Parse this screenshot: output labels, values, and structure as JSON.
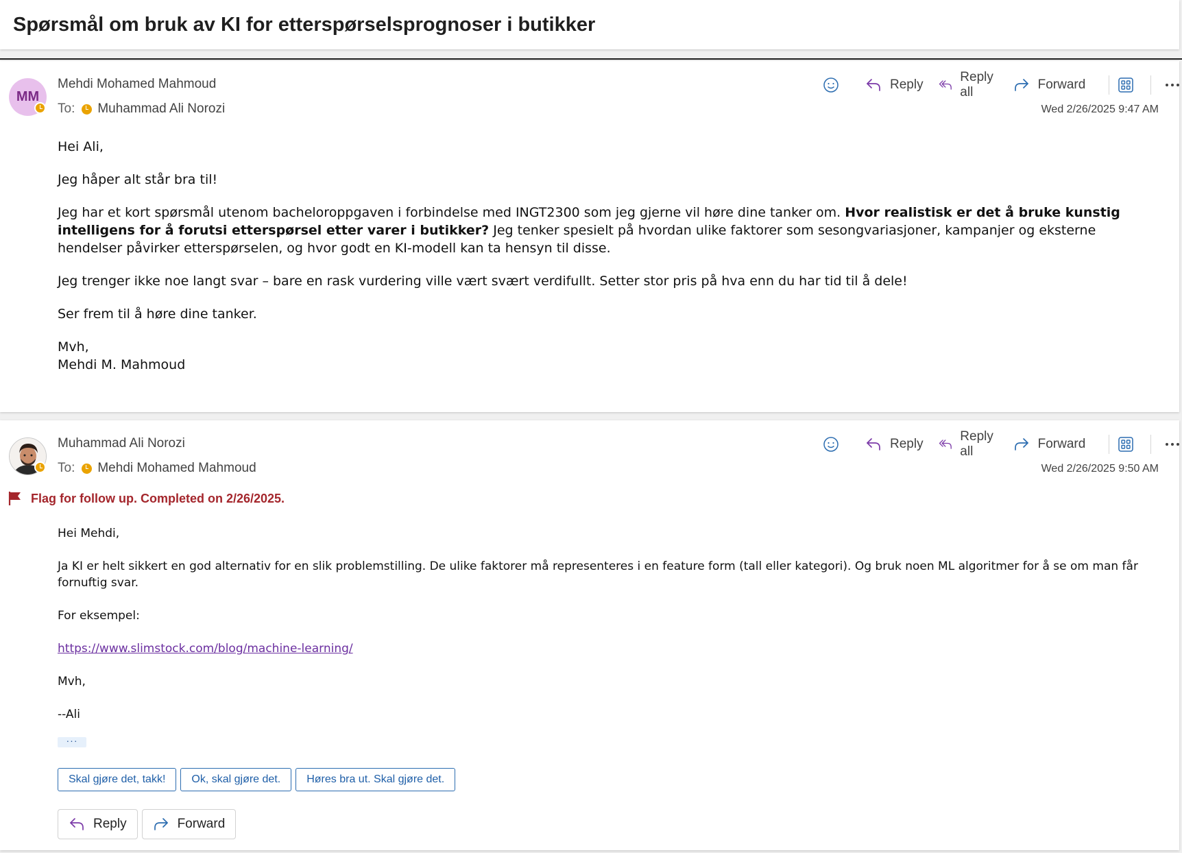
{
  "subject": "Spørsmål om bruk av KI for etterspørselsprognoser i butikker",
  "actions": {
    "emoji_icon": "smiley-icon",
    "reply": "Reply",
    "reply_all": "Reply all",
    "forward": "Forward",
    "apps_icon": "apps-icon",
    "more": "···"
  },
  "messages": [
    {
      "avatar_initials": "MM",
      "sender": "Mehdi Mohamed Mahmoud",
      "to_label": "To:",
      "to": "Muhammad Ali Norozi",
      "date": "Wed 2/26/2025 9:47 AM",
      "body": {
        "greeting": "Hei Ali,",
        "p1": "Jeg håper alt står bra til!",
        "p2_start": "Jeg har et kort spørsmål utenom bacheloroppgaven i forbindelse med INGT2300 som jeg gjerne vil høre dine tanker om.",
        "p2_bold": "Hvor realistisk er det å bruke kunstig intelligens for å forutsi etterspørsel etter varer i butikker?",
        "p2_end": "Jeg tenker spesielt på hvordan ulike faktorer som sesongvariasjoner, kampanjer og eksterne hendelser påvirker etterspørselen, og hvor godt en KI-modell kan ta hensyn til disse.",
        "p3": "Jeg trenger ikke noe langt svar – bare en rask vurdering ville vært svært verdifullt. Setter stor pris på hva enn du har tid til å dele!",
        "p4": "Ser frem til å høre dine tanker.",
        "signoff": "Mvh,",
        "signature": "Mehdi M. Mahmoud"
      }
    },
    {
      "sender": "Muhammad Ali Norozi",
      "to_label": "To:",
      "to": "Mehdi Mohamed Mahmoud",
      "date": "Wed 2/26/2025 9:50 AM",
      "flag": "Flag for follow up. Completed on 2/26/2025.",
      "body": {
        "greeting": "Hei Mehdi,",
        "p1": "Ja KI er helt sikkert en god alternativ for en slik problemstilling. De ulike faktorer må representeres i en feature form (tall eller kategori).  Og bruk noen ML algoritmer for å se om man får fornuftig svar.",
        "p2": "For eksempel:",
        "link": "https://www.slimstock.com/blog/machine-learning/",
        "signoff": "Mvh,",
        "signature": "--Ali"
      },
      "expand": "···",
      "quick_replies": [
        "Skal gjøre det, takk!",
        "Ok, skal gjøre det.",
        "Høres bra ut. Skal gjøre det."
      ],
      "bottom_reply": "Reply",
      "bottom_forward": "Forward"
    }
  ]
}
